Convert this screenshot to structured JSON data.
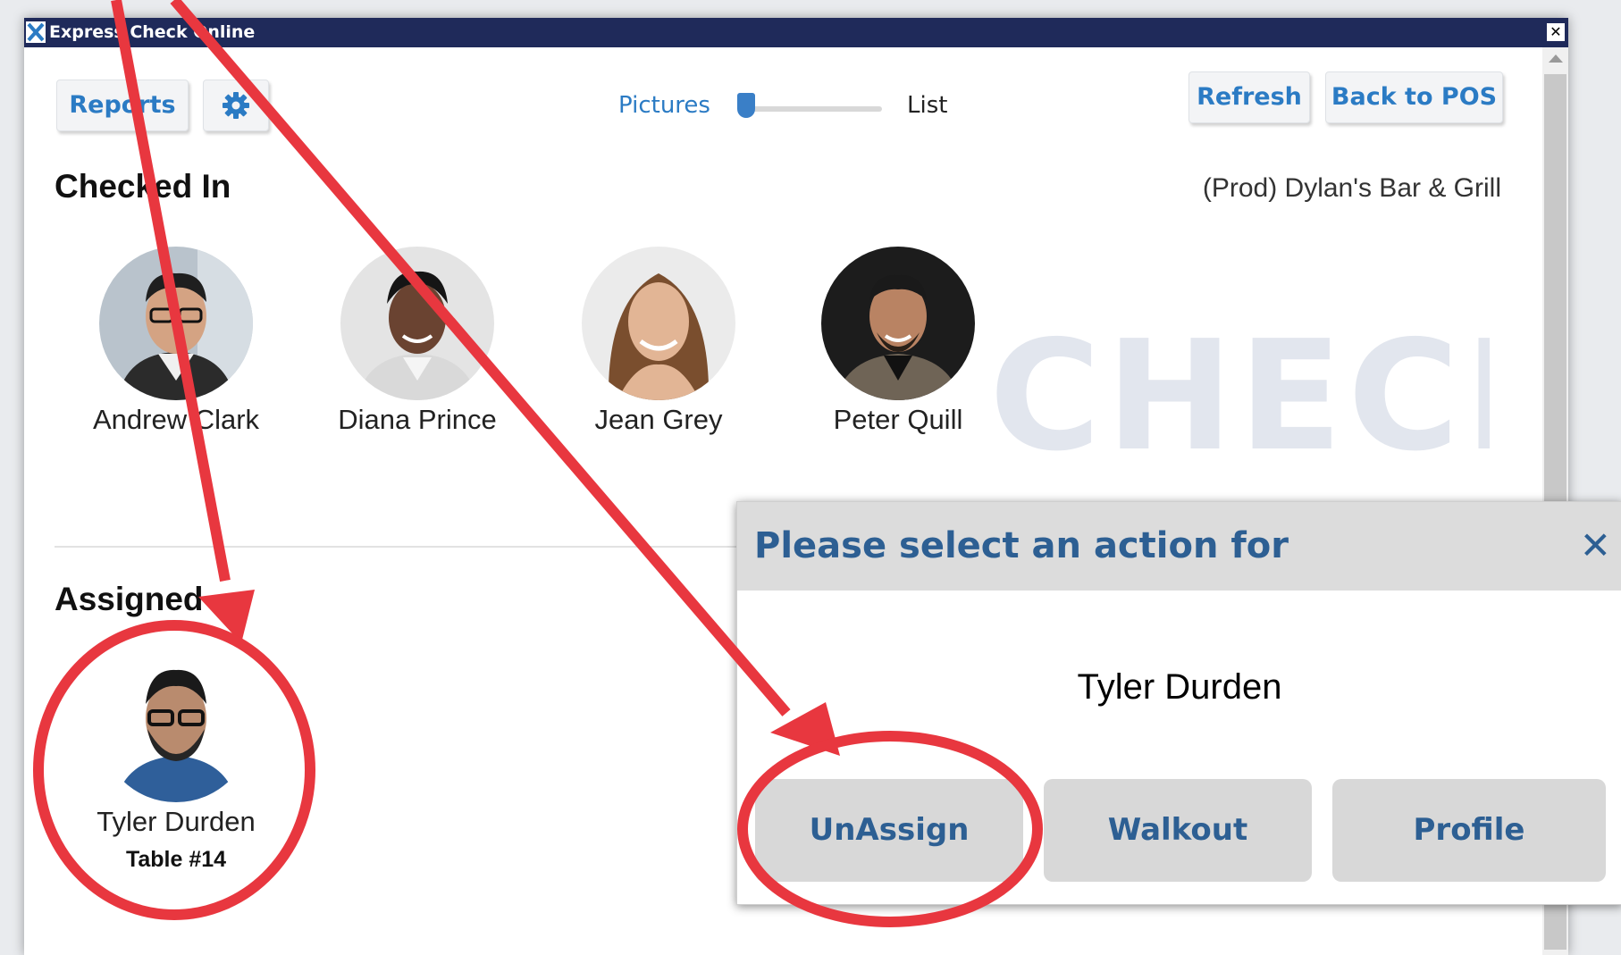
{
  "window": {
    "title": "Express Check Online",
    "close_glyph": "✕"
  },
  "toolbar": {
    "reports_label": "Reports",
    "settings_icon": "gear-icon",
    "view_toggle": {
      "left_label": "Pictures",
      "right_label": "List",
      "selected": "Pictures"
    },
    "refresh_label": "Refresh",
    "back_label": "Back to POS"
  },
  "checked_in": {
    "heading": "Checked In",
    "venue": "(Prod) Dylan's Bar & Grill",
    "watermark": "CHECK",
    "people": [
      {
        "name": "Andrew Clark"
      },
      {
        "name": "Diana Prince"
      },
      {
        "name": "Jean Grey"
      },
      {
        "name": "Peter Quill"
      }
    ]
  },
  "assigned": {
    "heading": "Assigned",
    "people": [
      {
        "name": "Tyler Durden",
        "table": "Table #14"
      }
    ]
  },
  "dialog": {
    "title": "Please select an action for",
    "close_glyph": "✕",
    "name": "Tyler Durden",
    "buttons": {
      "unassign": "UnAssign",
      "walkout": "Walkout",
      "profile": "Profile"
    }
  },
  "colors": {
    "accent": "#2b7bc4",
    "dialog_text": "#2d5f93",
    "annotation": "#e8373f",
    "titlebar": "#1f2a5a"
  }
}
